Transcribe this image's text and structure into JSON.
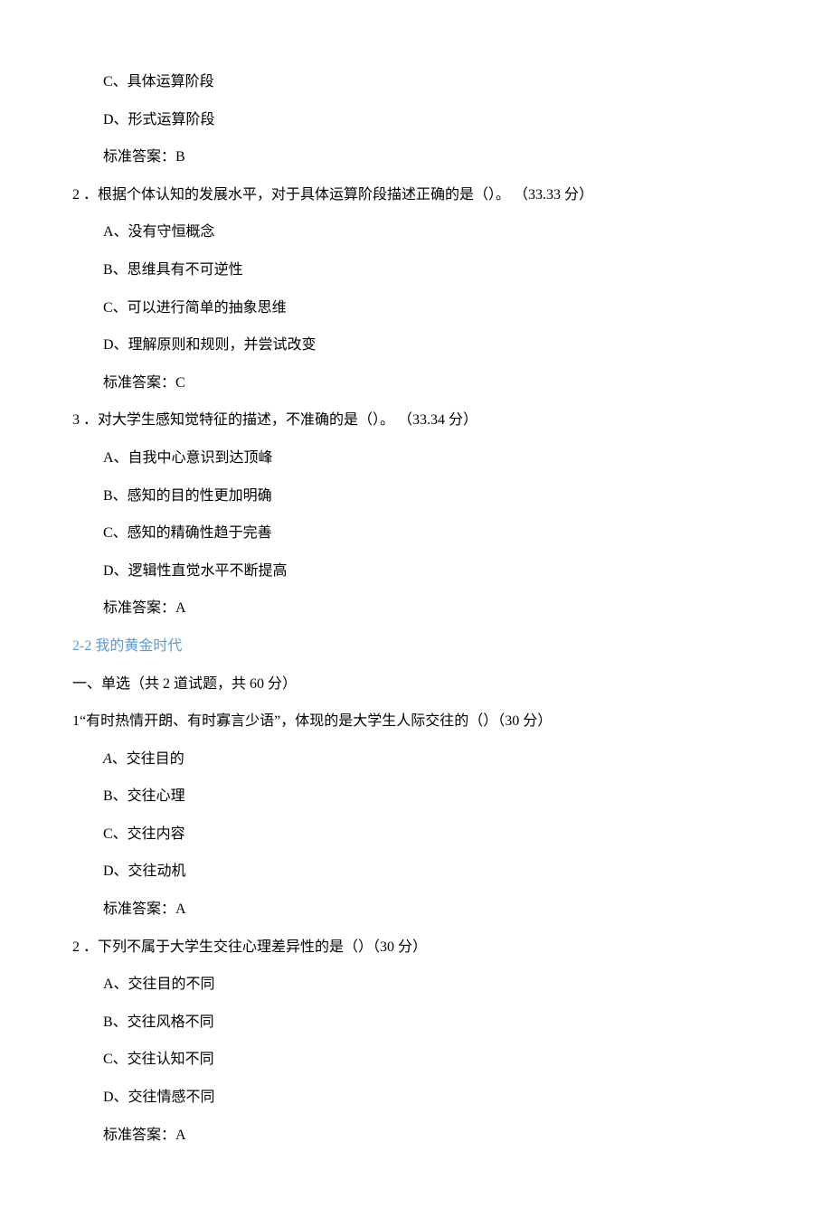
{
  "q1": {
    "option_c": "C、具体运算阶段",
    "option_d": "D、形式运算阶段",
    "answer": "标准答案：B"
  },
  "q2": {
    "stem": "2 ．根据个体认知的发展水平，对于具体运算阶段描述正确的是（）。 （33.33 分）",
    "option_a": "A、没有守恒概念",
    "option_b": "B、思维具有不可逆性",
    "option_c": "C、可以进行简单的抽象思维",
    "option_d": "D、理解原则和规则，并尝试改变",
    "answer": "标准答案：C"
  },
  "q3": {
    "stem": "3 ．对大学生感知觉特征的描述，不准确的是（）。 （33.34 分）",
    "option_a": "A、自我中心意识到达顶峰",
    "option_b": "B、感知的目的性更加明确",
    "option_c": "C、感知的精确性趋于完善",
    "option_d": "D、逻辑性直觉水平不断提高",
    "answer": "标准答案：A"
  },
  "section2": {
    "title": "2-2 我的黄金时代",
    "instruction": "一、单选（共 2 道试题，共 60 分）"
  },
  "q4": {
    "stem": "1“有时热情开朗、有时寡言少语”，体现的是大学生人际交往的（）（30 分）",
    "option_a_prefix": "A",
    "option_a_text": "、交往目的",
    "option_b": "B、交往心理",
    "option_c": "C、交往内容",
    "option_d": "D、交往动机",
    "answer": "标准答案：A"
  },
  "q5": {
    "stem": "2 ．下列不属于大学生交往心理差异性的是（）（30 分）",
    "option_a": "A、交往目的不同",
    "option_b": "B、交往风格不同",
    "option_c": "C、交往认知不同",
    "option_d": "D、交往情感不同",
    "answer": "标准答案：A"
  }
}
